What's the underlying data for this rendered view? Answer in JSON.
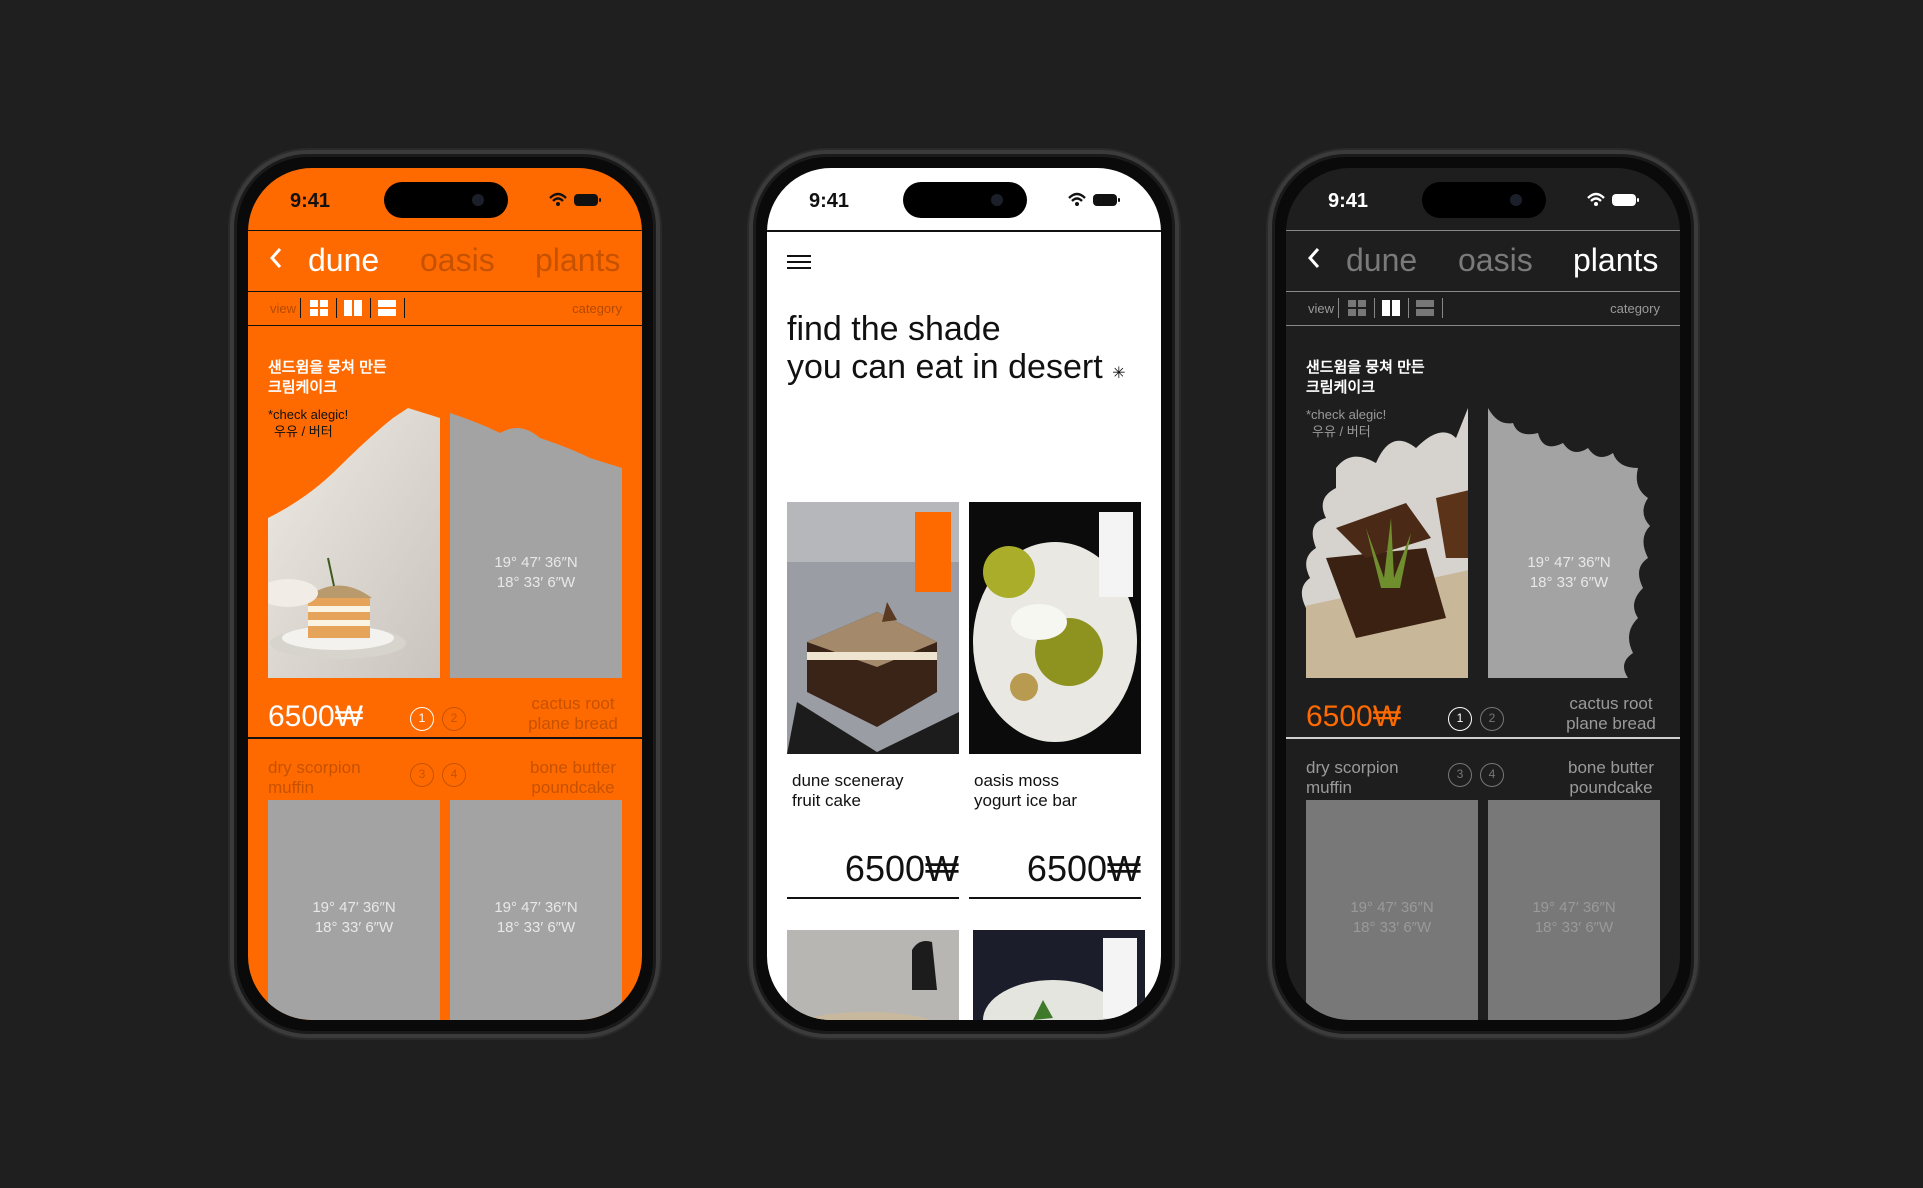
{
  "status": {
    "time": "9:41"
  },
  "nav": {
    "tabs": [
      "dune",
      "oasis",
      "plants"
    ],
    "back_icon": "chevron-left-icon"
  },
  "filter": {
    "view_label": "view",
    "category_label": "category"
  },
  "product": {
    "title_ko_line1": "샌드윔을 뭉쳐 만든",
    "title_ko_line2": "크림케이크",
    "allergy_note": "*check alegic!",
    "allergens": "우유 / 버터",
    "price": "6500₩",
    "coord_lat": "19° 47′ 36″N",
    "coord_lon": "18° 33′ 6″W",
    "pager": [
      "1",
      "2",
      "3",
      "4"
    ],
    "items": [
      {
        "line1": "cactus root",
        "line2": "plane bread"
      },
      {
        "line1": "dry scorpion",
        "line2": "muffin"
      },
      {
        "line1": "bone butter",
        "line2": "poundcake"
      }
    ]
  },
  "home": {
    "headline_line1": "find the shade",
    "headline_line2": "you can eat in desert",
    "star": "✳",
    "items": [
      {
        "line1": "dune sceneray",
        "line2": "fruit cake",
        "price": "6500₩"
      },
      {
        "line1": "oasis moss",
        "line2": "yogurt ice bar",
        "price": "6500₩"
      }
    ]
  },
  "colors": {
    "orange": "#ff6a00",
    "dark": "#1e1e1e",
    "white": "#ffffff",
    "placeholder": "#a3a3a3"
  }
}
